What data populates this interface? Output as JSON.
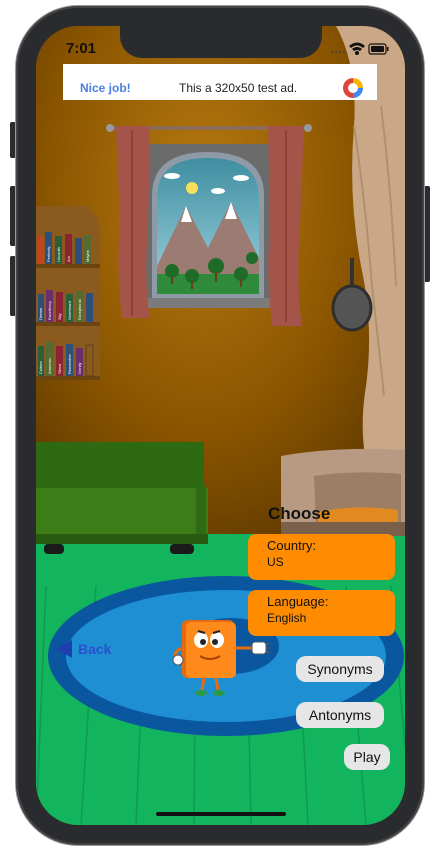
{
  "status": {
    "time": "7:01"
  },
  "ad": {
    "left_text": "Nice job!",
    "right_text": "This a 320x50 test ad.",
    "logo_icon": "ad-logo-icon"
  },
  "choose": {
    "title": "Choose",
    "country": {
      "label": "Country:",
      "value": "US"
    },
    "language": {
      "label": "Language:",
      "value": "English"
    },
    "synonyms": "Synonyms",
    "antonyms": "Antonyms",
    "play": "Play"
  },
  "nav": {
    "back": "Back"
  },
  "colors": {
    "accent": "#ff8c00",
    "back_blue": "#2a4fcf",
    "pill_bg": "#e6e6e6"
  },
  "books": {
    "row1": [
      "",
      "Perfectly",
      "Uncouth",
      "Act",
      "Maybe"
    ],
    "row2": [
      "Dream",
      "Excellency",
      "Sky",
      "Overheard",
      "Exceptional"
    ],
    "row3": [
      "Culture",
      "Amnesia",
      "Silent",
      "Remember",
      "Gently"
    ]
  }
}
